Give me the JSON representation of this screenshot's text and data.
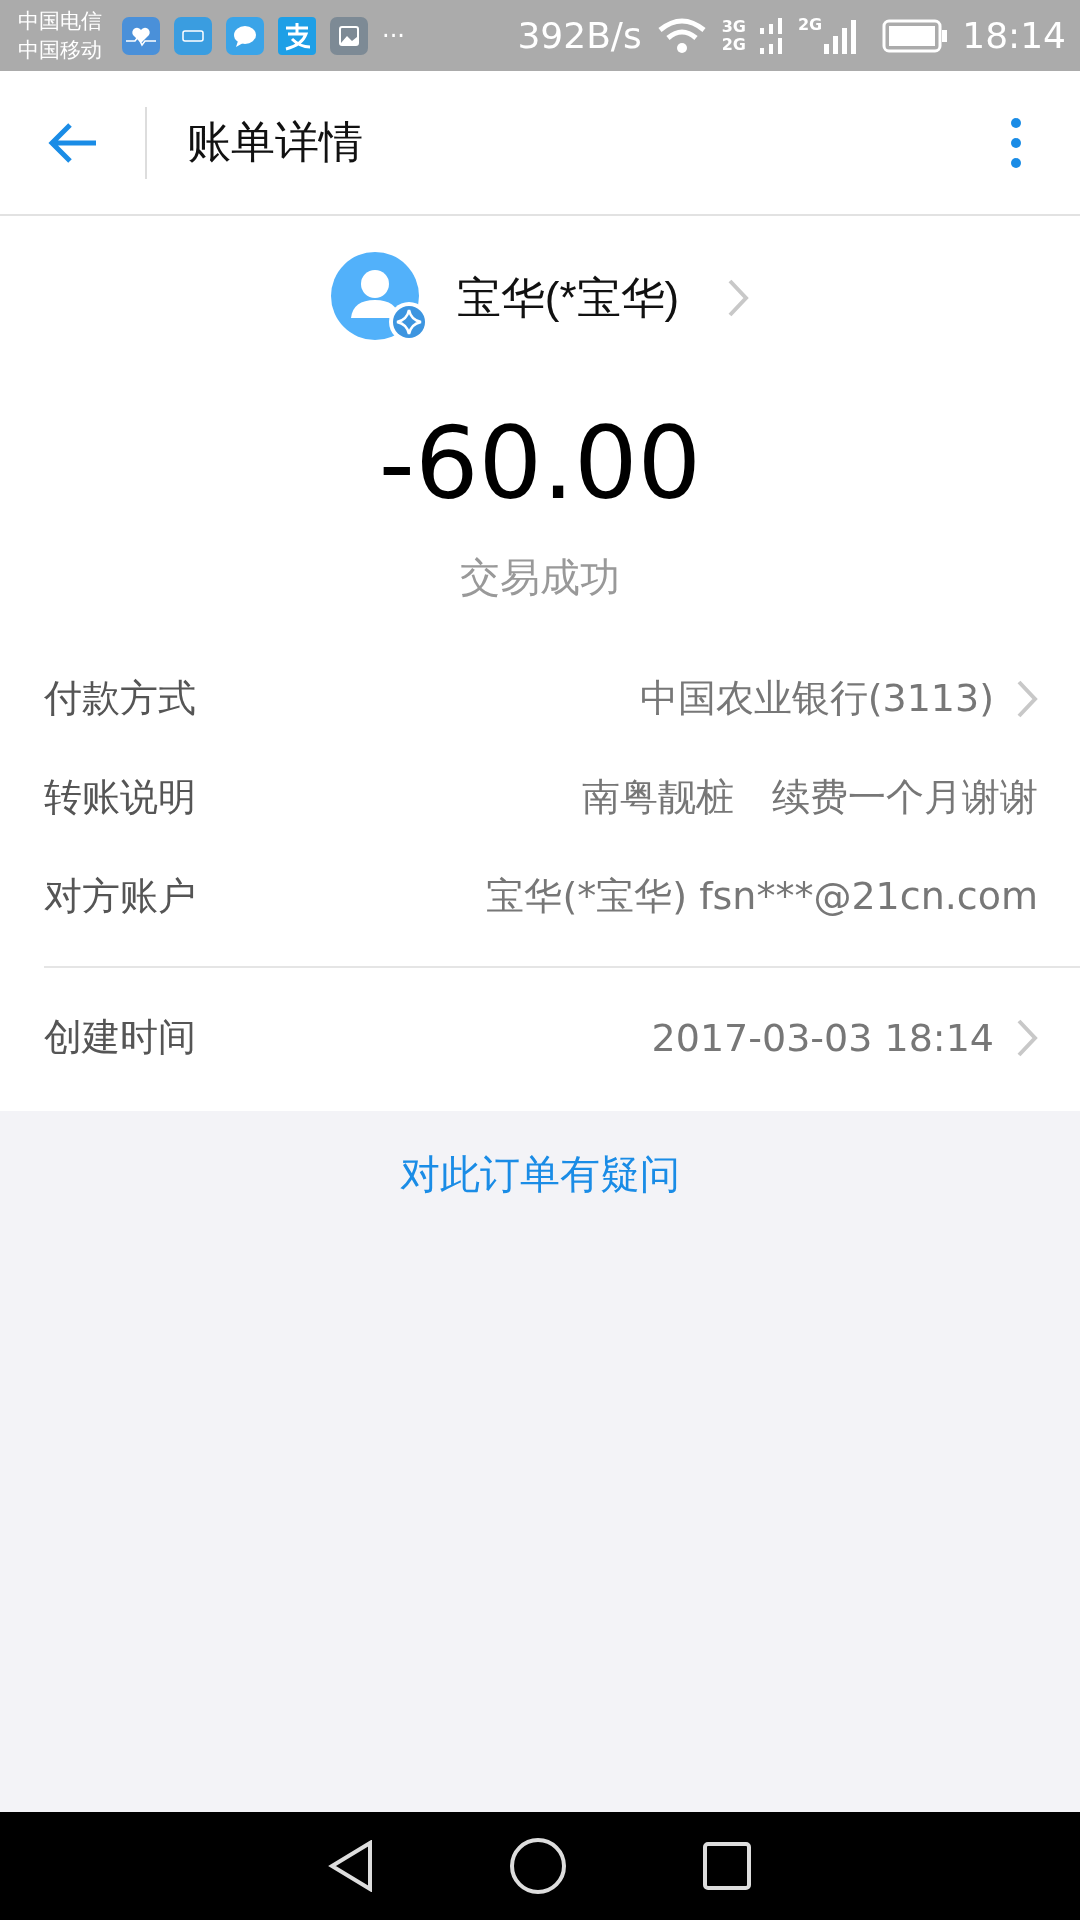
{
  "status_bar": {
    "carriers": [
      "中国电信",
      "中国移动"
    ],
    "more": "···",
    "speed": "392B/s",
    "network_labels": [
      "3G",
      "2G",
      "2G"
    ],
    "time": "18:14"
  },
  "header": {
    "title": "账单详情"
  },
  "payee": {
    "name": "宝华(*宝华)"
  },
  "amount": "-60.00",
  "status": "交易成功",
  "details": [
    {
      "label": "付款方式",
      "value": "中国农业银行(3113)",
      "chevron": true
    },
    {
      "label": "转账说明",
      "value": "南粤靓桩　续费一个月谢谢",
      "chevron": false
    },
    {
      "label": "对方账户",
      "value": "宝华(*宝华) fsn***@21cn.com",
      "chevron": false
    }
  ],
  "created": {
    "label": "创建时间",
    "value": "2017-03-03 18:14",
    "chevron": true
  },
  "question_link": "对此订单有疑问"
}
